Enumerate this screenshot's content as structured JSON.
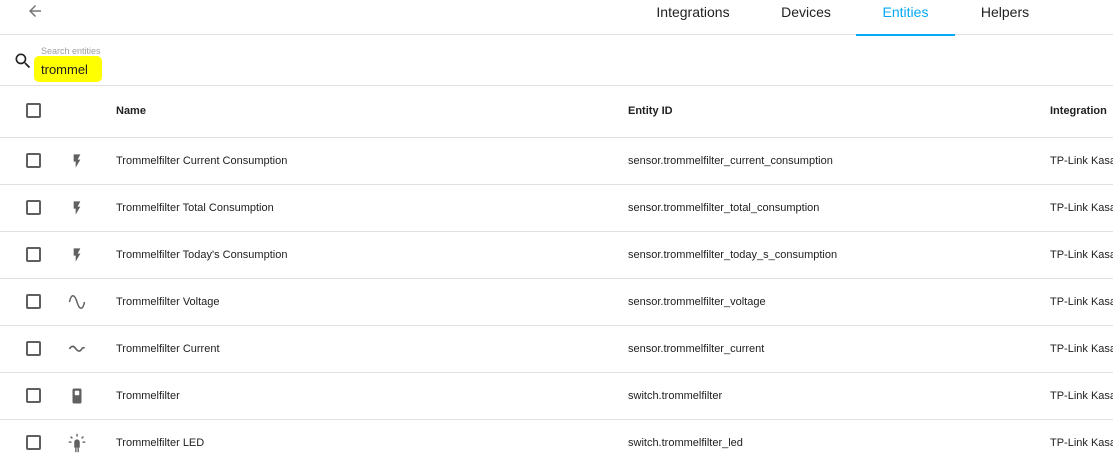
{
  "tabs": [
    {
      "label": "Integrations",
      "active": false
    },
    {
      "label": "Devices",
      "active": false
    },
    {
      "label": "Entities",
      "active": true
    },
    {
      "label": "Helpers",
      "active": false
    }
  ],
  "search": {
    "label": "Search entities",
    "value": "trommel",
    "highlight_color": "#ffff00"
  },
  "table": {
    "headers": {
      "name": "Name",
      "entity_id": "Entity ID",
      "integration": "Integration"
    },
    "rows": [
      {
        "icon": "flash-icon",
        "name": "Trommelfilter Current Consumption",
        "entity_id": "sensor.trommelfilter_current_consumption",
        "integration": "TP-Link Kasa Smart"
      },
      {
        "icon": "flash-icon",
        "name": "Trommelfilter Total Consumption",
        "entity_id": "sensor.trommelfilter_total_consumption",
        "integration": "TP-Link Kasa Smart"
      },
      {
        "icon": "flash-icon",
        "name": "Trommelfilter Today's Consumption",
        "entity_id": "sensor.trommelfilter_today_s_consumption",
        "integration": "TP-Link Kasa Smart"
      },
      {
        "icon": "sine-wave-icon",
        "name": "Trommelfilter Voltage",
        "entity_id": "sensor.trommelfilter_voltage",
        "integration": "TP-Link Kasa Smart"
      },
      {
        "icon": "current-ac-icon",
        "name": "Trommelfilter Current",
        "entity_id": "sensor.trommelfilter_current",
        "integration": "TP-Link Kasa Smart"
      },
      {
        "icon": "switch-icon",
        "name": "Trommelfilter",
        "entity_id": "switch.trommelfilter",
        "integration": "TP-Link Kasa Smart"
      },
      {
        "icon": "led-on-icon",
        "name": "Trommelfilter LED",
        "entity_id": "switch.trommelfilter_led",
        "integration": "TP-Link Kasa Smart"
      }
    ]
  },
  "colors": {
    "accent": "#03a9f4",
    "icon": "#616161",
    "divider": "#e0e0e0"
  }
}
